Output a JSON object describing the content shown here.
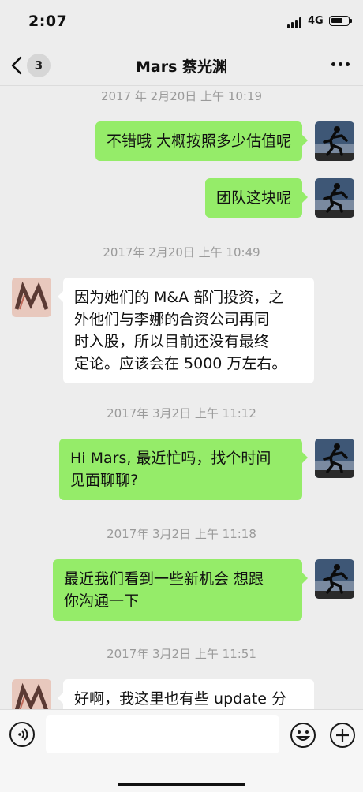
{
  "status_bar": {
    "time": "2:07",
    "network": "4G"
  },
  "nav": {
    "unread_count": "3",
    "title": "Mars 蔡光渊"
  },
  "messages": [
    {
      "type": "timestamp",
      "text": "2017 年 2月20日 上午 10:19"
    },
    {
      "type": "sent",
      "lines": [
        "不错哦 大概按照多少估值呢"
      ]
    },
    {
      "type": "sent",
      "lines": [
        "团队这块呢"
      ]
    },
    {
      "type": "timestamp",
      "text": "2017年 2月20日 上午 10:49"
    },
    {
      "type": "received",
      "lines": [
        "因为她们的 M&A 部门投资，之",
        "外他们与李娜的合资公司再同",
        "时入股，所以目前还没有最终",
        "定论。应该会在 5000 万左右。"
      ]
    },
    {
      "type": "timestamp",
      "text": "2017年 3月2日 上午 11:12"
    },
    {
      "type": "sent",
      "lines": [
        "Hi Mars, 最近忙吗，找个时间",
        "见面聊聊?"
      ]
    },
    {
      "type": "timestamp",
      "text": "2017年 3月2日 上午 11:18"
    },
    {
      "type": "sent",
      "lines": [
        "最近我们看到一些新机会 想跟",
        "你沟通一下"
      ]
    },
    {
      "type": "timestamp",
      "text": "2017年 3月2日 上午 11:51"
    },
    {
      "type": "received",
      "lines": [
        "好啊，我这里也有些 update 分"
      ]
    }
  ],
  "input": {
    "placeholder": ""
  },
  "colors": {
    "sent_bubble": "#95ec69",
    "received_bubble": "#ffffff",
    "background": "#ededed"
  }
}
